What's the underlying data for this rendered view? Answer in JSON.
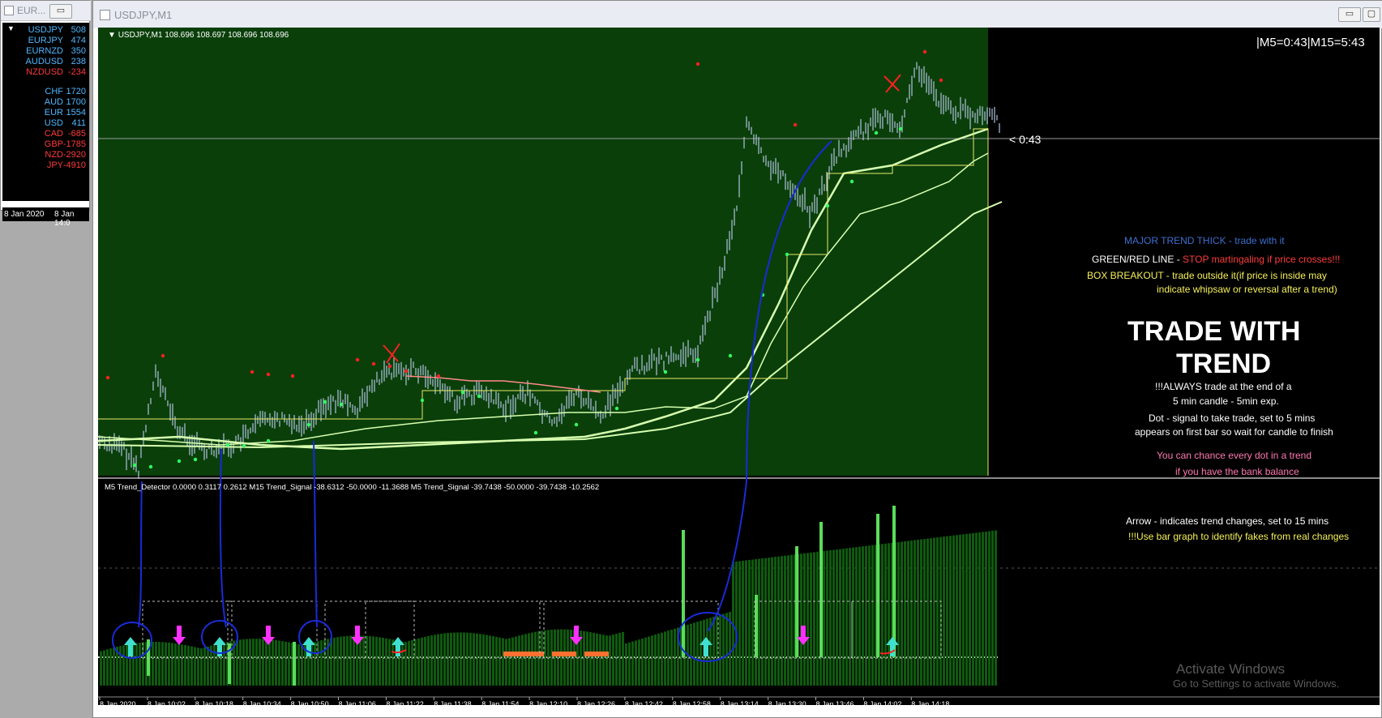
{
  "left_window": {
    "title": "EUR...",
    "restore_btn": "▭",
    "close_btn": "▢",
    "pairs": [
      {
        "name": "USDJPY",
        "value": "508",
        "color": "#4fb7ff"
      },
      {
        "name": "EURJPY",
        "value": "474",
        "color": "#4fb7ff"
      },
      {
        "name": "EURNZD",
        "value": "350",
        "color": "#4fb7ff"
      },
      {
        "name": "AUDUSD",
        "value": "238",
        "color": "#4fb7ff"
      },
      {
        "name": "NZDUSD",
        "value": "-234",
        "color": "#ff3b3b"
      }
    ],
    "currencies": [
      {
        "name": "CHF",
        "value": "1720",
        "color": "#4fb7ff"
      },
      {
        "name": "AUD",
        "value": "1700",
        "color": "#4fb7ff"
      },
      {
        "name": "EUR",
        "value": "1554",
        "color": "#4fb7ff"
      },
      {
        "name": "USD",
        "value": "411",
        "color": "#4fb7ff"
      },
      {
        "name": "CAD",
        "value": "-685",
        "color": "#ff3b3b"
      },
      {
        "name": "GBP",
        "value": "-1785",
        "color": "#ff3b3b"
      },
      {
        "name": "NZD",
        "value": "-2920",
        "color": "#ff3b3b"
      },
      {
        "name": "JPY",
        "value": "-4910",
        "color": "#ff3b3b"
      }
    ],
    "axis": [
      "8 Jan 2020",
      "8 Jan 14:0"
    ]
  },
  "main_window": {
    "title": "USDJPY,M1",
    "minimize_btn": "▭",
    "close_btn": "▢"
  },
  "chart_header": "USDJPY,M1  108.696 108.697 108.696 108.696",
  "timer": "|M5=0:43|M15=5:43",
  "price_marker": "< 0:43",
  "indicator_header": "M5 Trend_Detector 0.0000 0.3117 0.2612  M15 Trend_Signal -38.6312 -50.0000 -11.3688  M5 Trend_Signal -39.7438 -50.0000 -39.7438 -10.2562",
  "annotations": {
    "major_trend": "MAJOR TREND THICK  -  trade with it",
    "green_red_prefix": "GREEN/RED LINE - ",
    "green_red_warning": "STOP martingaling if price crosses!!!",
    "box_breakout_1": "BOX BREAKOUT - trade outside it(if price is inside may",
    "box_breakout_2": "indicate whipsaw or reversal after a trend)",
    "trade_with_1": "TRADE WITH",
    "trade_with_2": "TREND",
    "always_1": "!!!ALWAYS trade at the end of a",
    "always_2": "5 min candle - 5min exp.",
    "dot_1": "Dot - signal to take trade, set to 5 mins",
    "dot_2": "appears on first bar so wait for candle to finish",
    "chance_1": "You can chance every dot in a trend",
    "chance_2": "if you have the bank balance",
    "arrow_note": "Arrow - indicates trend changes, set to 15 mins",
    "bar_note": "!!!Use bar graph to identify fakes from real changes"
  },
  "time_axis": [
    "8 Jan 2020",
    "8 Jan 10:02",
    "8 Jan 10:18",
    "8 Jan 10:34",
    "8 Jan 10:50",
    "8 Jan 11:06",
    "8 Jan 11:22",
    "8 Jan 11:38",
    "8 Jan 11:54",
    "8 Jan 12:10",
    "8 Jan 12:26",
    "8 Jan 12:42",
    "8 Jan 12:58",
    "8 Jan 13:14",
    "8 Jan 13:30",
    "8 Jan 13:46",
    "8 Jan 14:02",
    "8 Jan 14:18"
  ],
  "watermark_1": "Activate Windows",
  "watermark_2": "Go to Settings to activate Windows.",
  "colors": {
    "chart_bg": "#000000",
    "session_bg": "#0a3f0a",
    "candles": "#b0c4de",
    "trend_line": "#d8ffb0",
    "box_line": "#e8e86a",
    "signal_up": "#30ff60",
    "signal_down": "#ff2020",
    "arrow_up": "#40e0d0",
    "arrow_down": "#ff30ff",
    "annotation_blue": "#3f6fd0",
    "annotation_pink": "#ff78b0",
    "annotation_yellow": "#f5f05a"
  }
}
